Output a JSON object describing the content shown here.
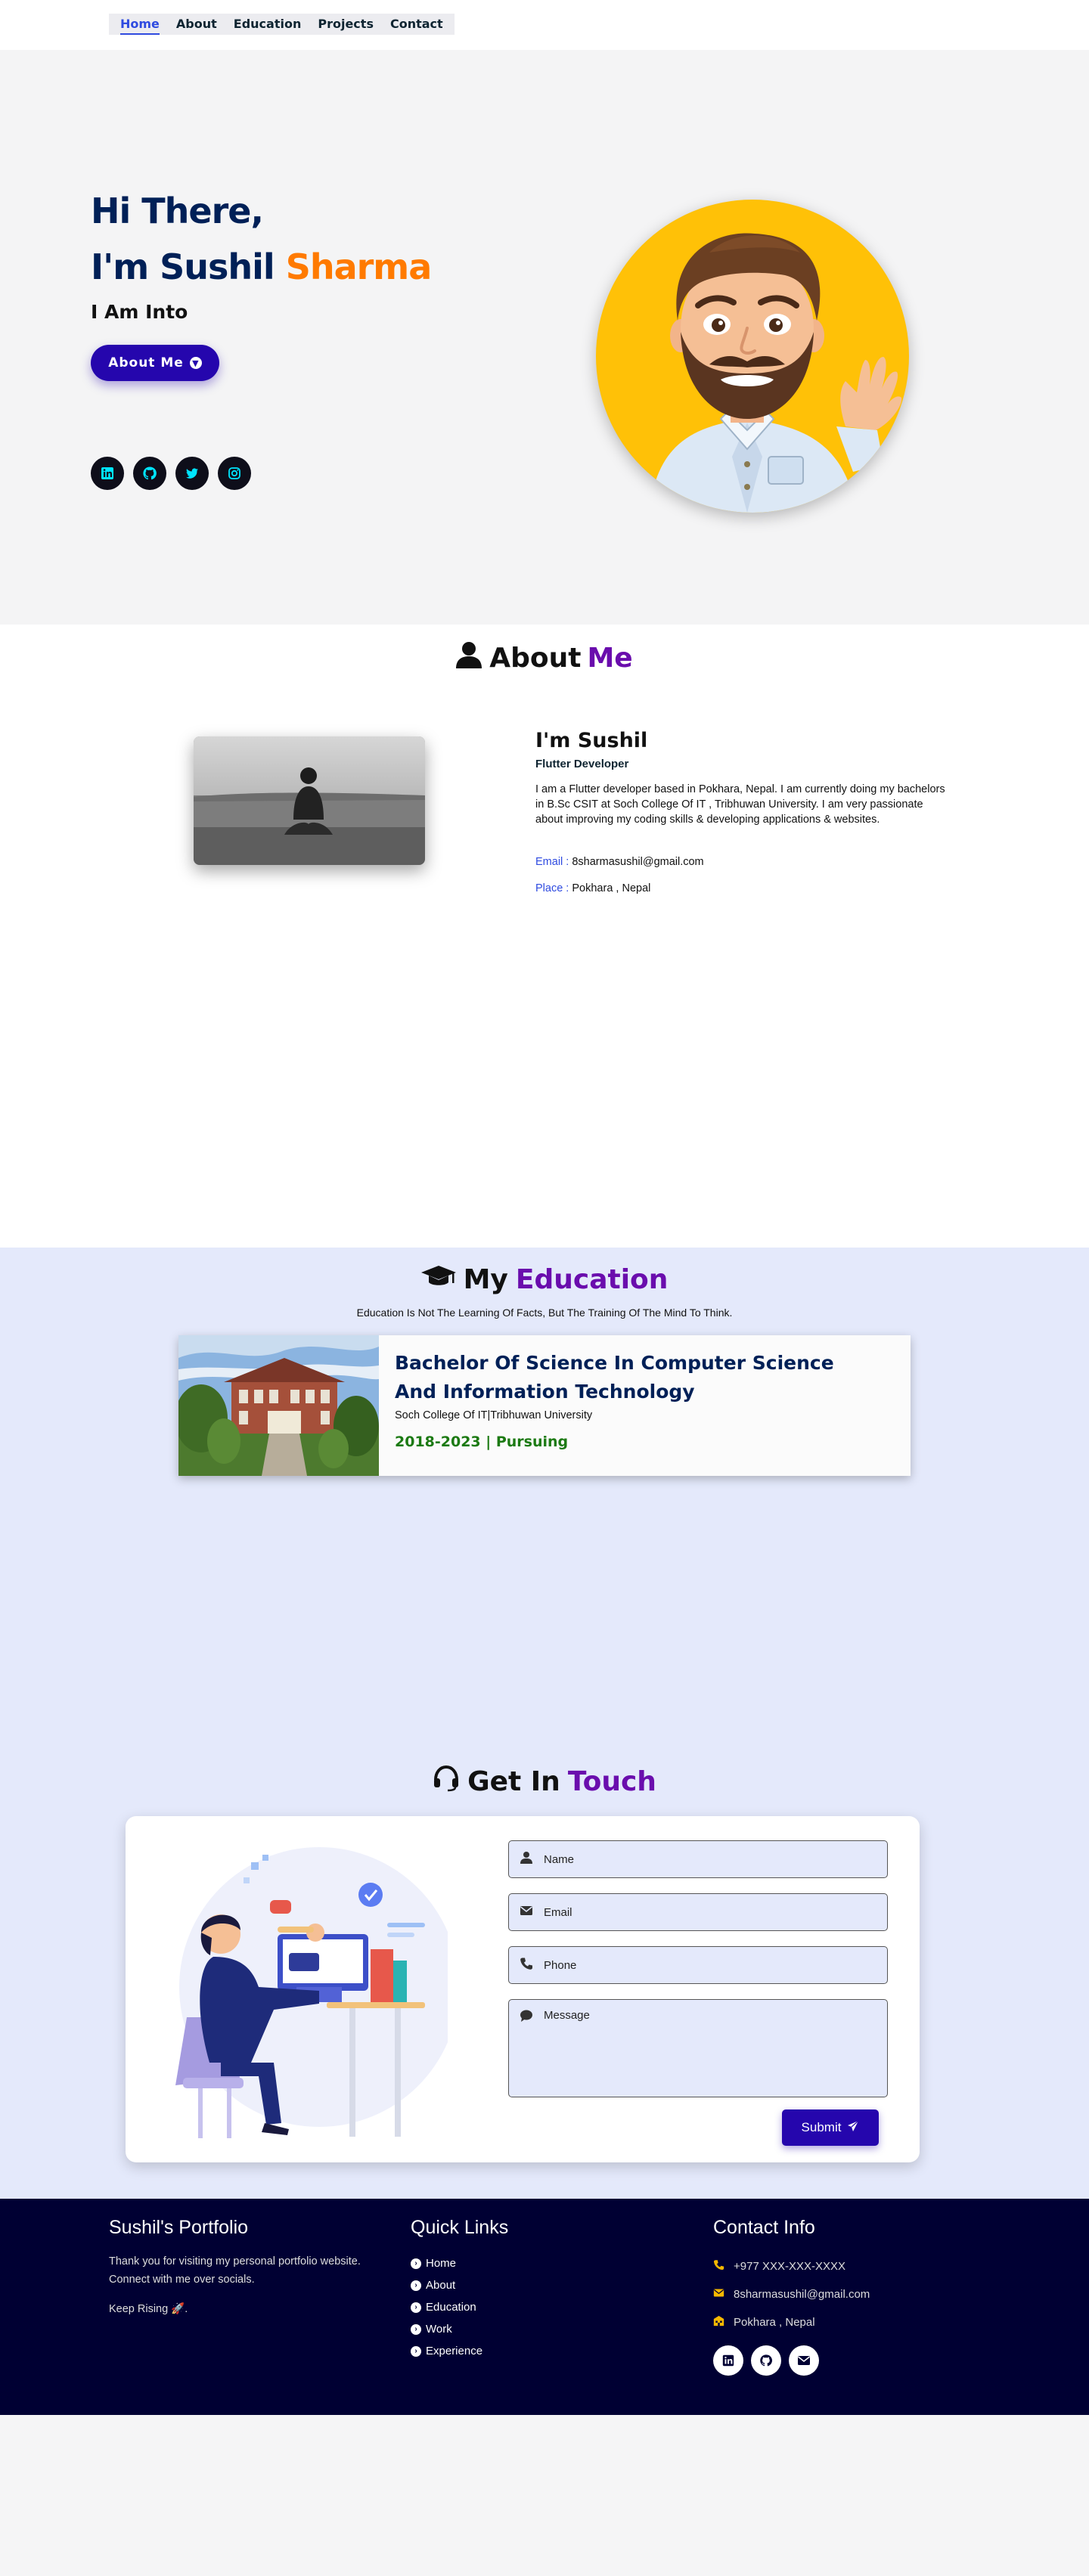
{
  "nav": {
    "items": [
      {
        "label": "Home",
        "active": true
      },
      {
        "label": "About"
      },
      {
        "label": "Education"
      },
      {
        "label": "Projects"
      },
      {
        "label": "Contact"
      }
    ]
  },
  "hero": {
    "greeting": "Hi There,",
    "name_prefix": "I'm Sushil",
    "name_highlight": "Sharma",
    "subtitle": "I Am Into",
    "button_label": "About Me",
    "socials": [
      "linkedin-icon",
      "github-icon",
      "twitter-icon",
      "instagram-icon"
    ]
  },
  "about": {
    "title_prefix": "About",
    "title_highlight": "Me",
    "name": "I'm Sushil",
    "role": "Flutter Developer",
    "description": "I am a Flutter developer based in Pokhara, Nepal. I am currently doing my bachelors in B.Sc CSIT at Soch College Of IT , Tribhuwan University. I am very passionate about improving my coding skills & developing applications & websites.",
    "email_label": "Email :",
    "email": "8sharmasushil@gmail.com",
    "place_label": "Place :",
    "place": "Pokhara , Nepal"
  },
  "education": {
    "title_prefix": "My",
    "title_highlight": "Education",
    "quote": "Education Is Not The Learning Of Facts, But The Training Of The Mind To Think.",
    "degree": "Bachelor Of Science In Computer Science And Information Technology",
    "college": "Soch College Of IT|Tribhuwan University",
    "years": "2018-2023 | Pursuing"
  },
  "contact": {
    "title_prefix": "Get In",
    "title_highlight": "Touch",
    "name_placeholder": "Name",
    "email_placeholder": "Email",
    "phone_placeholder": "Phone",
    "message_placeholder": "Message",
    "submit_label": "Submit"
  },
  "footer": {
    "brand_title": "Sushil's Portfolio",
    "brand_text": "Thank you for visiting my personal portfolio website. Connect with me over socials.",
    "keep": "Keep Rising 🚀.",
    "links_title": "Quick Links",
    "links": [
      "Home",
      "About",
      "Education",
      "Work",
      "Experience"
    ],
    "info_title": "Contact Info",
    "phone": "+977 XXX-XXX-XXXX",
    "email": "8sharmasushil@gmail.com",
    "place": "Pokhara , Nepal",
    "socials": [
      "linkedin-icon",
      "github-icon",
      "mail-icon"
    ]
  },
  "colors": {
    "accent": "#2506ad",
    "heading_navy": "#002057",
    "highlight_orange": "#ff7a00",
    "highlight_purple": "#6a0dad",
    "footer_bg": "#000033",
    "section_bg": "#e4e9fb"
  }
}
